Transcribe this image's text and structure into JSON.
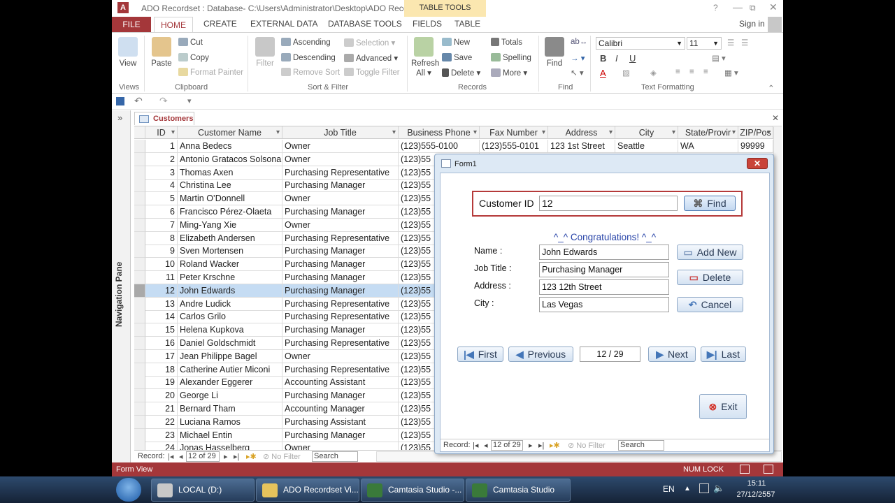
{
  "titlebar": {
    "title": "ADO Recordset : Database- C:\\Users\\Administrator\\Desktop\\ADO Recor...",
    "context_group": "TABLE TOOLS",
    "help": "?",
    "restore": "⧉",
    "close": "✕",
    "logo": "A"
  },
  "tabs": {
    "file": "FILE",
    "home": "HOME",
    "create": "CREATE",
    "external": "EXTERNAL DATA",
    "dbtools": "DATABASE TOOLS",
    "fields": "FIELDS",
    "table": "TABLE",
    "signin": "Sign in"
  },
  "ribbon": {
    "views": {
      "view": "View",
      "group": "Views"
    },
    "clipboard": {
      "paste": "Paste",
      "cut": "Cut",
      "copy": "Copy",
      "format_painter": "Format Painter",
      "group": "Clipboard"
    },
    "sort": {
      "filter": "Filter",
      "ascending": "Ascending",
      "descending": "Descending",
      "remove_sort": "Remove Sort",
      "selection": "Selection",
      "advanced": "Advanced",
      "toggle_filter": "Toggle Filter",
      "group": "Sort & Filter"
    },
    "records": {
      "refresh": "Refresh",
      "refresh2": "All",
      "new": "New",
      "save": "Save",
      "delete": "Delete",
      "totals": "Totals",
      "spelling": "Spelling",
      "more": "More",
      "group": "Records"
    },
    "find": {
      "find": "Find",
      "group": "Find"
    },
    "text": {
      "font": "Calibri",
      "size": "11",
      "group": "Text Formatting"
    }
  },
  "nav_pane": {
    "label": "Navigation Pane",
    "toggle": "»"
  },
  "doc": {
    "tab": "Customers",
    "close": "✕"
  },
  "columns": [
    "ID",
    "Customer Name",
    "Job Title",
    "Business Phone",
    "Fax Number",
    "Address",
    "City",
    "State/Provir",
    "ZIP/Pos"
  ],
  "rows": [
    [
      "1",
      "Anna Bedecs",
      "Owner",
      "(123)555-0100",
      "(123)555-0101",
      "123 1st Street",
      "Seattle",
      "WA",
      "99999"
    ],
    [
      "2",
      "Antonio Gratacos Solsona",
      "Owner",
      "(123)55"
    ],
    [
      "3",
      "Thomas Axen",
      "Purchasing Representative",
      "(123)55"
    ],
    [
      "4",
      "Christina Lee",
      "Purchasing Manager",
      "(123)55"
    ],
    [
      "5",
      "Martin O’Donnell",
      "Owner",
      "(123)55"
    ],
    [
      "6",
      "Francisco Pérez-Olaeta",
      "Purchasing Manager",
      "(123)55"
    ],
    [
      "7",
      "Ming-Yang Xie",
      "Owner",
      "(123)55"
    ],
    [
      "8",
      "Elizabeth Andersen",
      "Purchasing Representative",
      "(123)55"
    ],
    [
      "9",
      "Sven Mortensen",
      "Purchasing Manager",
      "(123)55"
    ],
    [
      "10",
      "Roland Wacker",
      "Purchasing Manager",
      "(123)55"
    ],
    [
      "11",
      "Peter Krschne",
      "Purchasing Manager",
      "(123)55"
    ],
    [
      "12",
      "John Edwards",
      "Purchasing Manager",
      "(123)55"
    ],
    [
      "13",
      "Andre Ludick",
      "Purchasing Representative",
      "(123)55"
    ],
    [
      "14",
      "Carlos Grilo",
      "Purchasing Representative",
      "(123)55"
    ],
    [
      "15",
      "Helena Kupkova",
      "Purchasing Manager",
      "(123)55"
    ],
    [
      "16",
      "Daniel Goldschmidt",
      "Purchasing Representative",
      "(123)55"
    ],
    [
      "17",
      "Jean Philippe Bagel",
      "Owner",
      "(123)55"
    ],
    [
      "18",
      "Catherine Autier Miconi",
      "Purchasing Representative",
      "(123)55"
    ],
    [
      "19",
      "Alexander Eggerer",
      "Accounting Assistant",
      "(123)55"
    ],
    [
      "20",
      "George Li",
      "Purchasing Manager",
      "(123)55"
    ],
    [
      "21",
      "Bernard Tham",
      "Accounting Manager",
      "(123)55"
    ],
    [
      "22",
      "Luciana Ramos",
      "Purchasing Assistant",
      "(123)55"
    ],
    [
      "23",
      "Michael Entin",
      "Purchasing Manager",
      "(123)55"
    ],
    [
      "24",
      "Jonas Hasselberg",
      "Owner",
      "(123)55"
    ]
  ],
  "navbar": {
    "record_label": "Record:",
    "position": "12 of 29",
    "no_filter": "No Filter",
    "search": "Search"
  },
  "status": {
    "left": "Form View",
    "numlock": "NUM LOCK"
  },
  "form": {
    "title": "Form1",
    "customer_id_label": "Customer ID",
    "customer_id_value": "12",
    "find": "Find",
    "message": "^_^ Congratulations! ^_^",
    "name_label": "Name :",
    "name_value": "John Edwards",
    "jobtitle_label": "Job Title :",
    "jobtitle_value": "Purchasing Manager",
    "address_label": "Address :",
    "address_value": "123 12th Street",
    "city_label": "City :",
    "city_value": "Las Vegas",
    "add_new": "Add New",
    "delete": "Delete",
    "cancel": "Cancel",
    "first": "First",
    "previous": "Previous",
    "position": "12 / 29",
    "next": "Next",
    "last": "Last",
    "exit": "Exit",
    "nav_record": "Record:",
    "nav_position": "12 of 29",
    "nav_filter": "No Filter",
    "nav_search": "Search"
  },
  "taskbar": {
    "items": [
      "LOCAL (D:)",
      "ADO Recordset Vi...",
      "Camtasia Studio -...",
      "Camtasia Studio"
    ],
    "lang": "EN",
    "time": "15:11",
    "date": "27/12/2557"
  }
}
